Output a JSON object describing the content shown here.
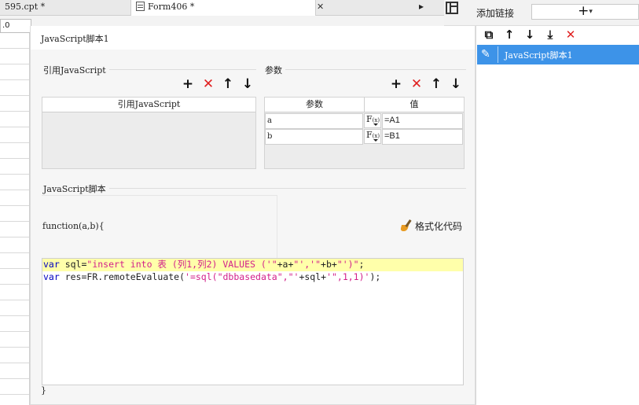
{
  "tabs": [
    {
      "label": "595.cpt *"
    },
    {
      "label": "Form406 *"
    }
  ],
  "cell_ref": ".0",
  "right_panel": {
    "title": "添加链接",
    "add_button": "+",
    "items": [
      {
        "label": "JavaScript脚本1"
      }
    ]
  },
  "dialog": {
    "title": "JavaScript脚本1",
    "ref_section": {
      "title": "引用JavaScript",
      "column_header": "引用JavaScript",
      "rows": []
    },
    "param_section": {
      "title": "参数",
      "columns": [
        "参数",
        "值"
      ],
      "rows": [
        {
          "name": "a",
          "fx": "F",
          "value": "=A1"
        },
        {
          "name": "b",
          "fx": "F",
          "value": "=B1"
        }
      ]
    },
    "script_section": {
      "title": "JavaScript脚本",
      "signature": "function(a,b){",
      "format_button": "格式化代码",
      "closing": "}"
    }
  },
  "code": {
    "line1": {
      "kw": "var",
      "a": " sql=",
      "s1": "\"insert into 表 (列1,列2) VALUES ('\"",
      "b": "+a+",
      "s2": "\"','\"",
      "c": "+b+",
      "s3": "\"')\"",
      "d": ";"
    },
    "line2": {
      "kw": "var",
      "a": " res=FR.remoteEvaluate(",
      "s1": "'=sql(\"dbbasedata\",\"'",
      "b": "+sql+",
      "s2": "'\",1,1)'",
      "d": ");"
    }
  },
  "colors": {
    "selection": "#3d93e8",
    "delete": "#e02020",
    "highlight": "#ffffaa"
  }
}
